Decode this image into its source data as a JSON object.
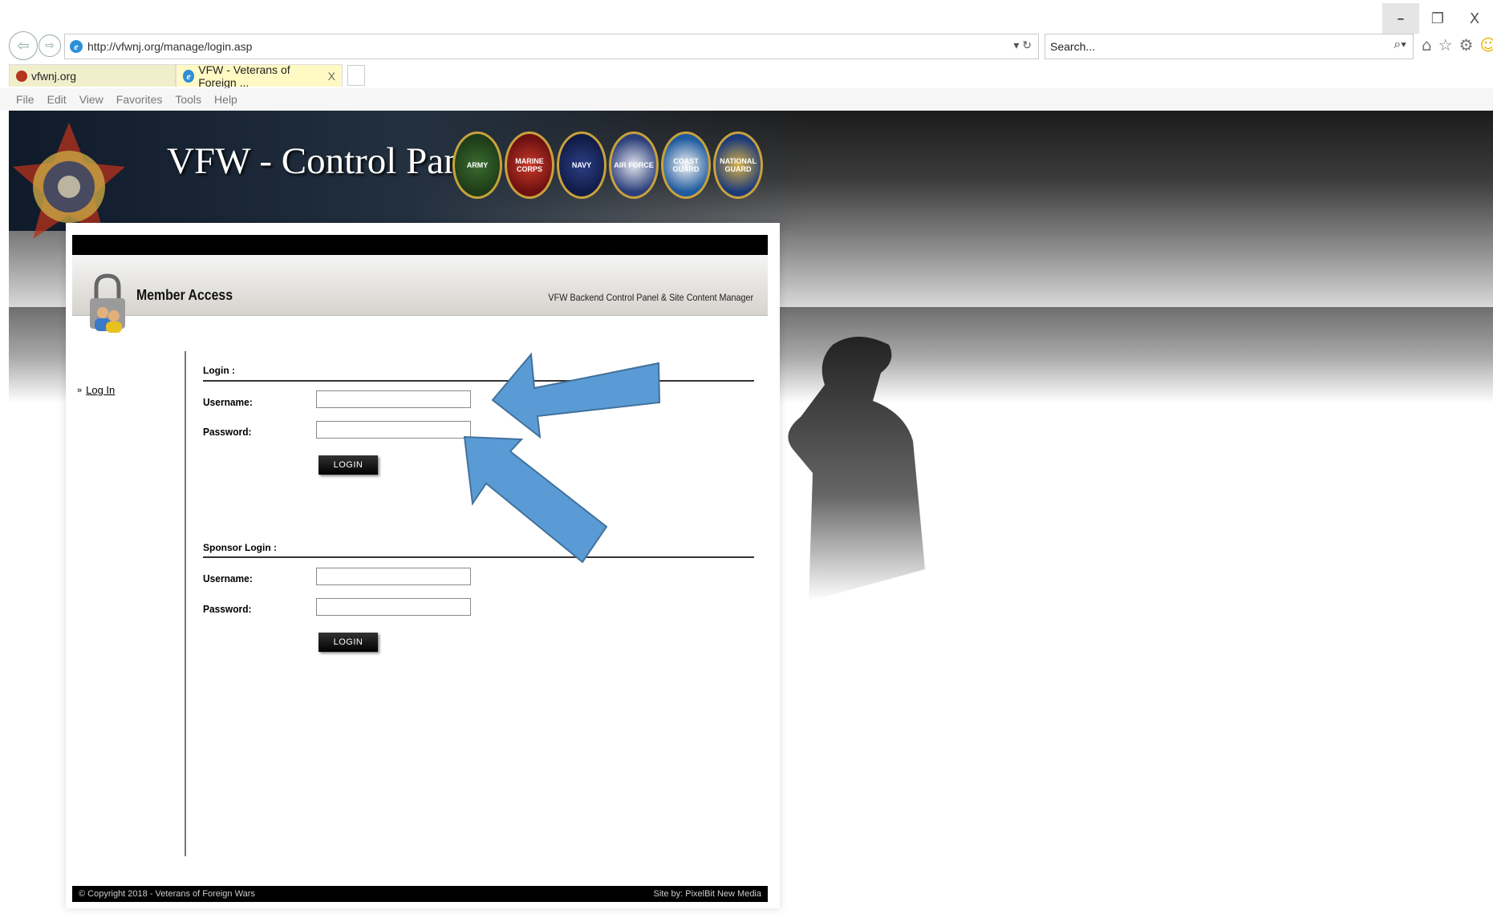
{
  "browser": {
    "url": "http://vfwnj.org/manage/login.asp",
    "search_placeholder": "Search...",
    "tabs": [
      {
        "label": "vfwnj.org"
      },
      {
        "label": "VFW - Veterans of Foreign ..."
      }
    ],
    "menu": [
      "File",
      "Edit",
      "View",
      "Favorites",
      "Tools",
      "Help"
    ],
    "window_controls": {
      "minimize": "–",
      "restore": "❐",
      "close": "X"
    }
  },
  "banner": {
    "title": "VFW - Control Panel",
    "seals": [
      "ARMY",
      "MARINE CORPS",
      "NAVY",
      "AIR FORCE",
      "COAST GUARD",
      "NATIONAL GUARD"
    ]
  },
  "panel": {
    "header_title": "Member Access",
    "header_subtitle": "VFW Backend Control Panel & Site Content Manager",
    "sidebar_link": "Log In",
    "login": {
      "title": "Login :",
      "username_label": "Username:",
      "password_label": "Password:",
      "button": "LOGIN",
      "username_value": "",
      "password_value": ""
    },
    "sponsor": {
      "title": "Sponsor Login :",
      "username_label": "Username:",
      "password_label": "Password:",
      "button": "LOGIN",
      "username_value": "",
      "password_value": ""
    },
    "footer_left": "© Copyright 2018 - Veterans of Foreign Wars",
    "footer_right": "Site by: PixelBit New Media"
  },
  "colors": {
    "arrow": "#5b9bd5",
    "arrow_stroke": "#41719c"
  }
}
